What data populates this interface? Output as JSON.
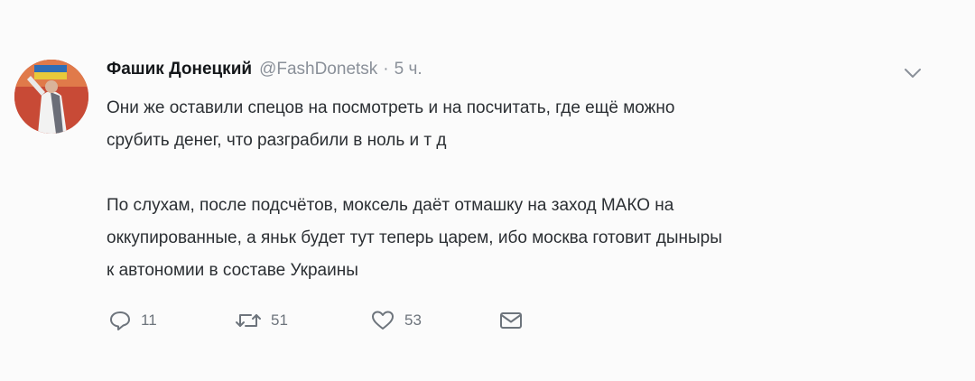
{
  "tweet": {
    "author": {
      "display_name": "Фашик Донецкий",
      "handle": "@FashDonetsk",
      "separator": "·",
      "time": "5 ч."
    },
    "text_lines": [
      "Они же оставили спецов на посмотреть и на посчитать, где ещё можно",
      "срубить денег, что разграбили в ноль и т д",
      "",
      "По слухам, после подсчётов, моксель даёт отмашку на заход МАКО на",
      "оккупированные, а яньк будет тут теперь царем, ибо москва готовит дыныры",
      "к автономии в составе Украины"
    ],
    "actions": {
      "reply": {
        "icon": "reply-icon",
        "count": "11"
      },
      "retweet": {
        "icon": "retweet-icon",
        "count": "51"
      },
      "like": {
        "icon": "heart-icon",
        "count": "53"
      },
      "dm": {
        "icon": "envelope-icon"
      }
    },
    "menu_icon": "chevron-down-icon"
  }
}
